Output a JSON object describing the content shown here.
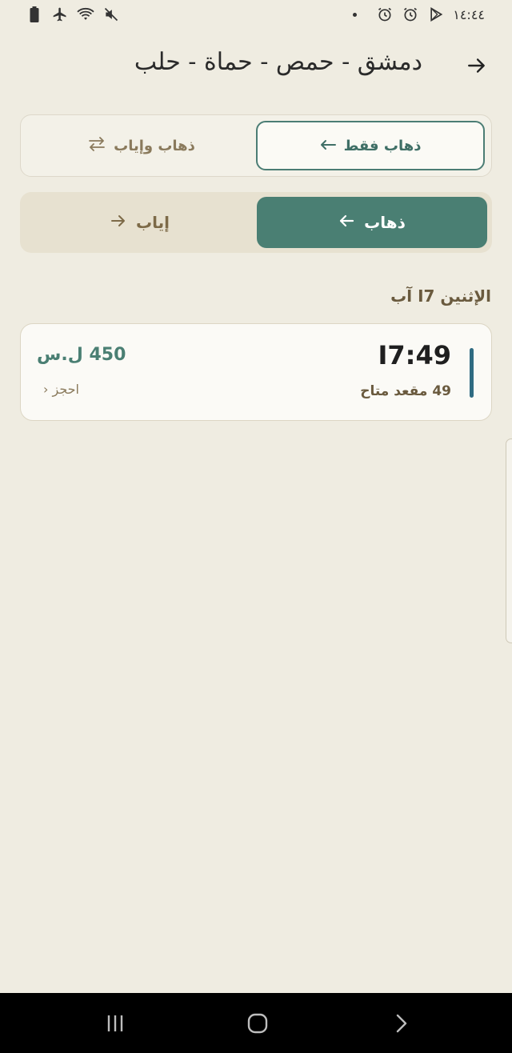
{
  "status_bar": {
    "time": "١٤:٤٤",
    "left_icons": [
      "battery-icon",
      "airplane-icon",
      "wifi-icon",
      "mute-icon"
    ],
    "right_icons": [
      "alarm-icon",
      "alarm-icon",
      "play-store-icon"
    ]
  },
  "header": {
    "title": "دمشق - حمص - حماة - حلب",
    "back_icon": "arrow-right-icon"
  },
  "trip_type": {
    "one_way_label": "ذهاب فقط",
    "round_trip_label": "ذهاب وإياب",
    "selected": "one_way"
  },
  "direction": {
    "go_label": "ذهاب",
    "return_label": "إياب",
    "selected": "go"
  },
  "date_label": "الإثنين I7 آب",
  "trips": [
    {
      "time": "I7:49",
      "seats": "49 مقعد متاح",
      "price": "450 ل.س",
      "book_label": "احجز ‹"
    }
  ],
  "colors": {
    "background": "#efece1",
    "accent": "#4a7f73",
    "card_bar": "#2f6b82",
    "muted_brown": "#6a5a3e"
  }
}
